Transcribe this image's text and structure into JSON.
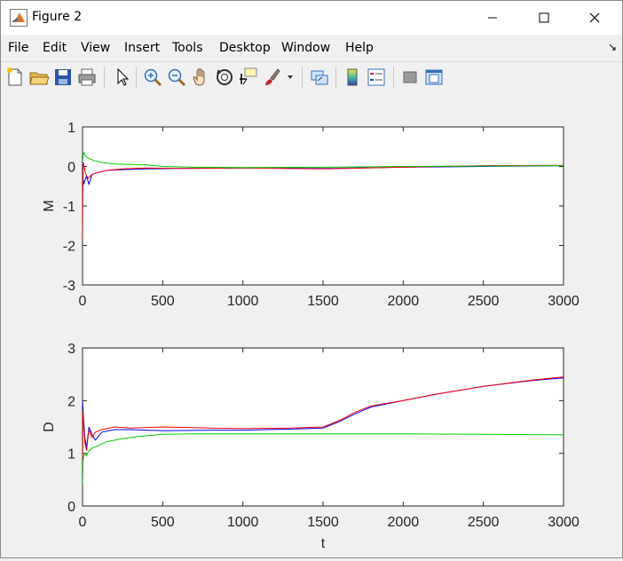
{
  "window": {
    "title": "Figure 2"
  },
  "menu": [
    "File",
    "Edit",
    "View",
    "Insert",
    "Tools",
    "Desktop",
    "Window",
    "Help"
  ],
  "toolbar": [
    "new-figure-icon",
    "open-file-icon",
    "save-icon",
    "print-icon",
    "edit-plot-arrow-icon",
    "zoom-in-icon",
    "zoom-out-icon",
    "pan-hand-icon",
    "rotate-3d-icon",
    "data-cursor-icon",
    "brush-icon",
    "link-plot-icon",
    "insert-colorbar-icon",
    "insert-legend-icon",
    "hide-plot-tools-icon",
    "show-plot-tools-icon"
  ],
  "colors": {
    "series_blue": "#0000ff",
    "series_red": "#ff0000",
    "series_green": "#00cc00",
    "axes_bg": "#ffffff"
  },
  "chart_data": [
    {
      "type": "line",
      "ylabel": "M",
      "xlabel": "",
      "xlim": [
        0,
        3000
      ],
      "ylim": [
        -3,
        1
      ],
      "xticks": [
        "0",
        "500",
        "1000",
        "1500",
        "2000",
        "2500",
        "3000"
      ],
      "yticks": [
        "1",
        "0",
        "-1",
        "-2",
        "-3"
      ],
      "series": [
        {
          "color": "#0000ff",
          "x": [
            0,
            3,
            8,
            15,
            25,
            40,
            60,
            100,
            150,
            250,
            400,
            600,
            1000,
            1500,
            2000,
            2500,
            3000
          ],
          "y": [
            0.1,
            -0.3,
            -0.45,
            -0.35,
            -0.25,
            -0.45,
            -0.2,
            -0.15,
            -0.1,
            -0.08,
            -0.06,
            -0.05,
            -0.04,
            -0.05,
            -0.02,
            0.0,
            0.02
          ]
        },
        {
          "color": "#ff0000",
          "x": [
            0,
            2,
            5,
            10,
            20,
            35,
            60,
            100,
            150,
            250,
            400,
            600,
            1000,
            1500,
            2000,
            2500,
            3000
          ],
          "y": [
            -1.9,
            -0.6,
            0.1,
            0.0,
            -0.2,
            -0.3,
            -0.2,
            -0.15,
            -0.1,
            -0.06,
            -0.04,
            -0.05,
            -0.04,
            -0.06,
            -0.02,
            0.02,
            0.03
          ]
        },
        {
          "color": "#00cc00",
          "x": [
            0,
            5,
            10,
            20,
            40,
            70,
            120,
            200,
            300,
            400,
            500,
            700,
            1000,
            1500,
            2000,
            2500,
            3000
          ],
          "y": [
            0.1,
            0.3,
            0.35,
            0.25,
            0.2,
            0.15,
            0.1,
            0.06,
            0.05,
            0.04,
            0.0,
            -0.02,
            -0.03,
            -0.02,
            0.0,
            0.01,
            0.02
          ]
        }
      ]
    },
    {
      "type": "line",
      "ylabel": "D",
      "xlabel": "t",
      "xlim": [
        0,
        3000
      ],
      "ylim": [
        0,
        3
      ],
      "xticks": [
        "0",
        "500",
        "1000",
        "1500",
        "2000",
        "2500",
        "3000"
      ],
      "yticks": [
        "3",
        "2",
        "1",
        "0"
      ],
      "series": [
        {
          "color": "#0000ff",
          "x": [
            0,
            3,
            8,
            15,
            25,
            40,
            60,
            80,
            120,
            200,
            300,
            500,
            800,
            1000,
            1300,
            1500,
            1600,
            1700,
            1800,
            2000,
            2200,
            2500,
            2800,
            3000
          ],
          "y": [
            2.0,
            1.85,
            1.6,
            1.3,
            1.1,
            1.5,
            1.35,
            1.25,
            1.4,
            1.45,
            1.45,
            1.43,
            1.44,
            1.44,
            1.46,
            1.48,
            1.6,
            1.75,
            1.88,
            2.0,
            2.12,
            2.27,
            2.38,
            2.43
          ]
        },
        {
          "color": "#ff0000",
          "x": [
            0,
            3,
            8,
            15,
            25,
            40,
            60,
            80,
            120,
            200,
            300,
            500,
            800,
            1000,
            1300,
            1500,
            1600,
            1700,
            1800,
            2000,
            2200,
            2500,
            2800,
            3000
          ],
          "y": [
            0.5,
            1.8,
            1.5,
            1.2,
            1.05,
            1.45,
            1.3,
            1.4,
            1.45,
            1.5,
            1.48,
            1.5,
            1.48,
            1.47,
            1.48,
            1.5,
            1.62,
            1.78,
            1.9,
            2.0,
            2.12,
            2.27,
            2.39,
            2.45
          ]
        },
        {
          "color": "#00cc00",
          "x": [
            0,
            3,
            8,
            15,
            25,
            40,
            60,
            100,
            150,
            250,
            350,
            500,
            700,
            1000,
            1500,
            2000,
            2500,
            3000
          ],
          "y": [
            0.4,
            0.85,
            0.95,
            1.0,
            0.95,
            1.05,
            1.1,
            1.15,
            1.22,
            1.28,
            1.32,
            1.36,
            1.37,
            1.37,
            1.37,
            1.37,
            1.36,
            1.35
          ]
        }
      ]
    }
  ]
}
